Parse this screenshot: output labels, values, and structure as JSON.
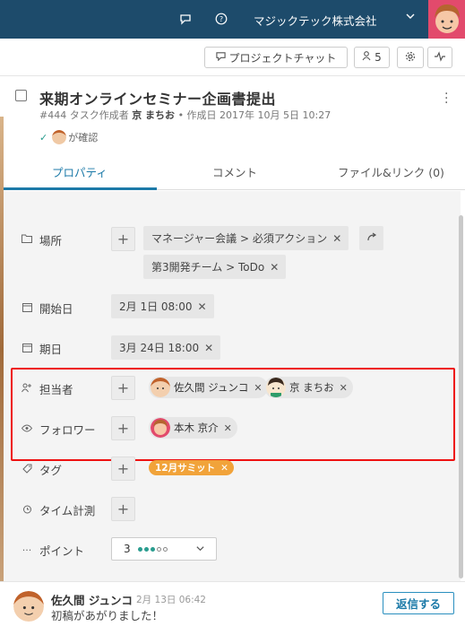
{
  "topbar": {
    "company": "マジックテック株式会社"
  },
  "toolbar": {
    "project_chat": "プロジェクトチャット",
    "member_count": "5"
  },
  "task": {
    "title": "来期オンラインセミナー企画書提出",
    "id": "#444",
    "creator_label": "タスク作成者",
    "creator": "京 まちお",
    "created": "• 作成日 2017年 10月 5日 10:27",
    "confirmed": "が確認"
  },
  "tabs": [
    "プロパティ",
    "コメント",
    "ファイル&リンク (0)"
  ],
  "props": {
    "location_label": "場所",
    "location_chips": [
      "マネージャー会議 > 必須アクション",
      "第3開発チーム > ToDo"
    ],
    "start_label": "開始日",
    "start_value": "2月 1日 08:00",
    "due_label": "期日",
    "due_value": "3月 24日 18:00",
    "assignee_label": "担当者",
    "assignees": [
      "佐久間 ジュンコ",
      "京 まちお"
    ],
    "follower_label": "フォロワー",
    "followers": [
      "本木 京介"
    ],
    "tag_label": "タグ",
    "tags": [
      "12月サミット"
    ],
    "time_label": "タイム計測",
    "point_label": "ポイント",
    "point_value": "3",
    "point_level": 3,
    "point_max": 5
  },
  "comment": {
    "author": "佐久間 ジュンコ",
    "date": "2月 13日 06:42",
    "text": "初稿があがりました！",
    "reply": "返信する"
  },
  "colors": {
    "topbar": "#1d4b6b",
    "accent": "#1c7aa8",
    "tag": "#f1a33a",
    "highlight": "#e11111",
    "point_on": "#2a9d8f"
  }
}
